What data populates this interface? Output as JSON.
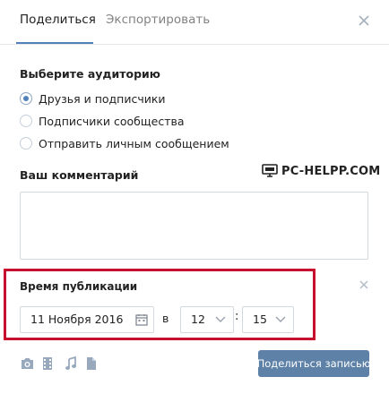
{
  "tabs": [
    {
      "label": "Поделиться",
      "active": true
    },
    {
      "label": "Экспортировать",
      "active": false
    }
  ],
  "audience": {
    "title": "Выберите аудиторию",
    "options": [
      {
        "label": "Друзья и подписчики",
        "checked": true
      },
      {
        "label": "Подписчики сообщества",
        "checked": false
      },
      {
        "label": "Отправить личным сообщением",
        "checked": false
      }
    ]
  },
  "comment": {
    "title": "Ваш комментарий",
    "value": ""
  },
  "watermark": {
    "text": "PC-HELPP.COM"
  },
  "publication": {
    "title": "Время публикации",
    "date": "11 Ноября 2016",
    "in_label": "в",
    "hour": "12",
    "separator": ":",
    "minute": "15"
  },
  "footer": {
    "submit_label": "Поделиться записью"
  },
  "colors": {
    "accent": "#5181b8",
    "button": "#5e81a8",
    "highlight": "#c8102e"
  }
}
